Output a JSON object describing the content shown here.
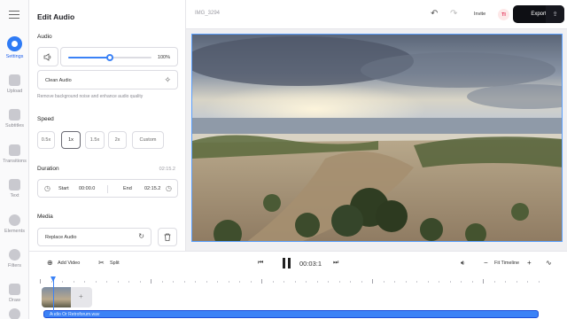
{
  "rail": {
    "items": [
      {
        "label": "Settings",
        "icon": "settings-icon",
        "active": true
      },
      {
        "label": "Upload",
        "icon": "plus-icon"
      },
      {
        "label": "Subtitles",
        "icon": "subtitles-icon"
      },
      {
        "label": "Transitions",
        "icon": "transitions-icon"
      },
      {
        "label": "Text",
        "icon": "text-icon"
      },
      {
        "label": "Elements",
        "icon": "elements-icon"
      },
      {
        "label": "Filters",
        "icon": "filters-icon"
      },
      {
        "label": "Draw",
        "icon": "pen-icon"
      },
      {
        "label": "",
        "icon": "help-icon"
      }
    ]
  },
  "panel": {
    "title": "Edit Audio",
    "audio_section": "Audio",
    "volume_value": "100%",
    "volume_level": 1.0,
    "clean_audio_label": "Clean Audio",
    "clean_audio_hint": "Remove background noise and enhance audio quality",
    "speed_section": "Speed",
    "speed_options": [
      "0.5x",
      "1x",
      "1.5x",
      "2x",
      "Custom"
    ],
    "speed_selected": "1x",
    "duration_section": "Duration",
    "duration_value": "02:15.2",
    "start_label": "Start",
    "start_value": "00:00.0",
    "end_label": "End",
    "end_value": "02:15.2",
    "media_section": "Media",
    "replace_audio_label": "Replace Audio"
  },
  "topbar": {
    "project_name": "IMG_3294",
    "invite_label": "Invite",
    "avatar_initials": "TI",
    "export_label": "Export"
  },
  "controls": {
    "add_video_label": "Add Video",
    "split_label": "Split",
    "time": "00:03:1",
    "fit_timeline_label": "Fit Timeline"
  },
  "timeline": {
    "audio_track_label": "Audio Or Retroforum.wav"
  },
  "colors": {
    "accent": "#2f7bf5",
    "export_bg": "#0e0f14",
    "audio_track": "#3b82f6"
  }
}
